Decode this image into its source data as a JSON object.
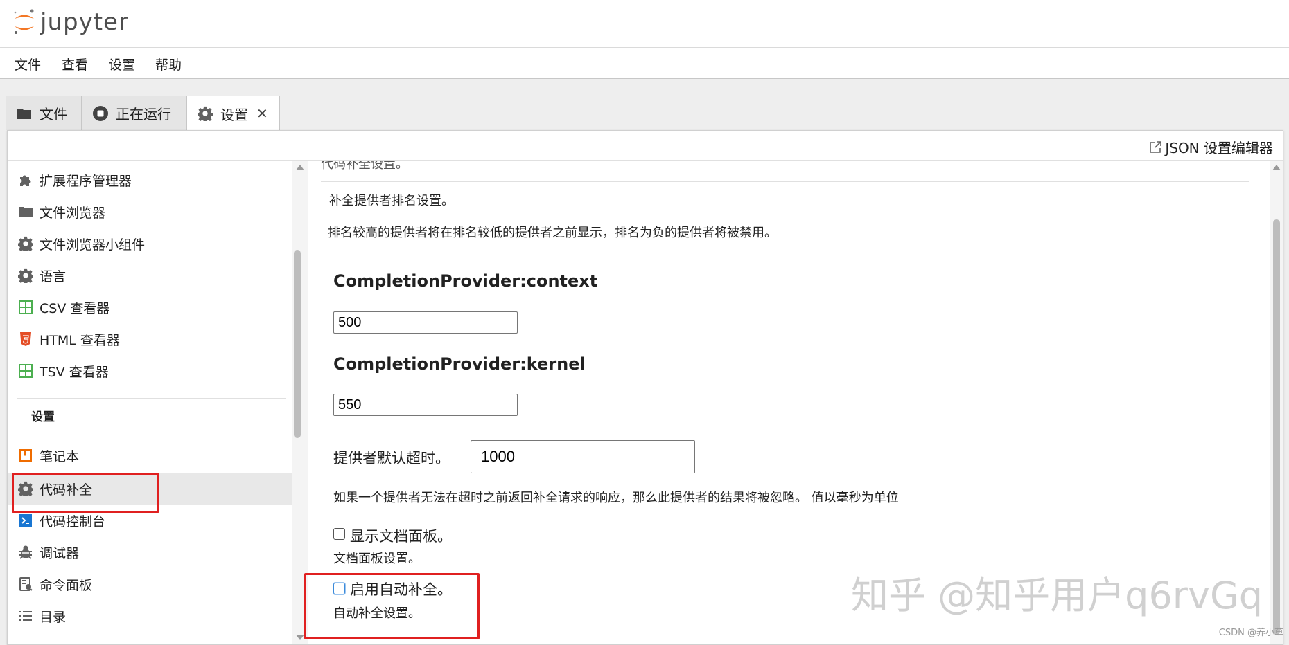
{
  "app": {
    "name": "jupyter"
  },
  "menu": [
    "文件",
    "查看",
    "设置",
    "帮助"
  ],
  "tabs": [
    {
      "label": "文件",
      "icon": "folder-icon"
    },
    {
      "label": "正在运行",
      "icon": "stop-circle-icon"
    },
    {
      "label": "设置",
      "icon": "gear-icon",
      "close": "✕"
    }
  ],
  "toolbar": {
    "json_editor_label": "JSON 设置编辑器"
  },
  "sidebar": {
    "items_top": [
      {
        "label": "扩展程序管理器",
        "icon": "puzzle-icon"
      },
      {
        "label": "文件浏览器",
        "icon": "folder-icon"
      },
      {
        "label": "文件浏览器小组件",
        "icon": "gear-icon"
      },
      {
        "label": "语言",
        "icon": "gear-icon"
      },
      {
        "label": "CSV 查看器",
        "icon": "grid-icon"
      },
      {
        "label": "HTML 查看器",
        "icon": "html5-icon"
      },
      {
        "label": "TSV 查看器",
        "icon": "grid-icon"
      }
    ],
    "section_header": "设置",
    "items_bottom": [
      {
        "label": "笔记本",
        "icon": "notebook-icon"
      },
      {
        "label": "代码补全",
        "icon": "gear-icon"
      },
      {
        "label": "代码控制台",
        "icon": "console-icon"
      },
      {
        "label": "调试器",
        "icon": "bug-icon"
      },
      {
        "label": "命令面板",
        "icon": "palette-icon"
      },
      {
        "label": "目录",
        "icon": "list-icon"
      }
    ]
  },
  "main": {
    "cut_title": "代码补全设置。",
    "ranking_title": "补全提供者排名设置。",
    "ranking_desc": "排名较高的提供者将在排名较低的提供者之前显示，排名为负的提供者将被禁用。",
    "provider_context_label": "CompletionProvider:context",
    "provider_context_value": "500",
    "provider_kernel_label": "CompletionProvider:kernel",
    "provider_kernel_value": "550",
    "timeout_label": "提供者默认超时。",
    "timeout_value": "1000",
    "timeout_desc": "如果一个提供者无法在超时之前返回补全请求的响应，那么此提供者的结果将被忽略。 值以毫秒为单位",
    "show_doc_label": "显示文档面板。",
    "show_doc_desc": "文档面板设置。",
    "auto_complete_label": "启用自动补全。",
    "auto_complete_desc": "自动补全设置。"
  },
  "watermark": "知乎 @知乎用户q6rvGq",
  "credit": "CSDN @养小草"
}
